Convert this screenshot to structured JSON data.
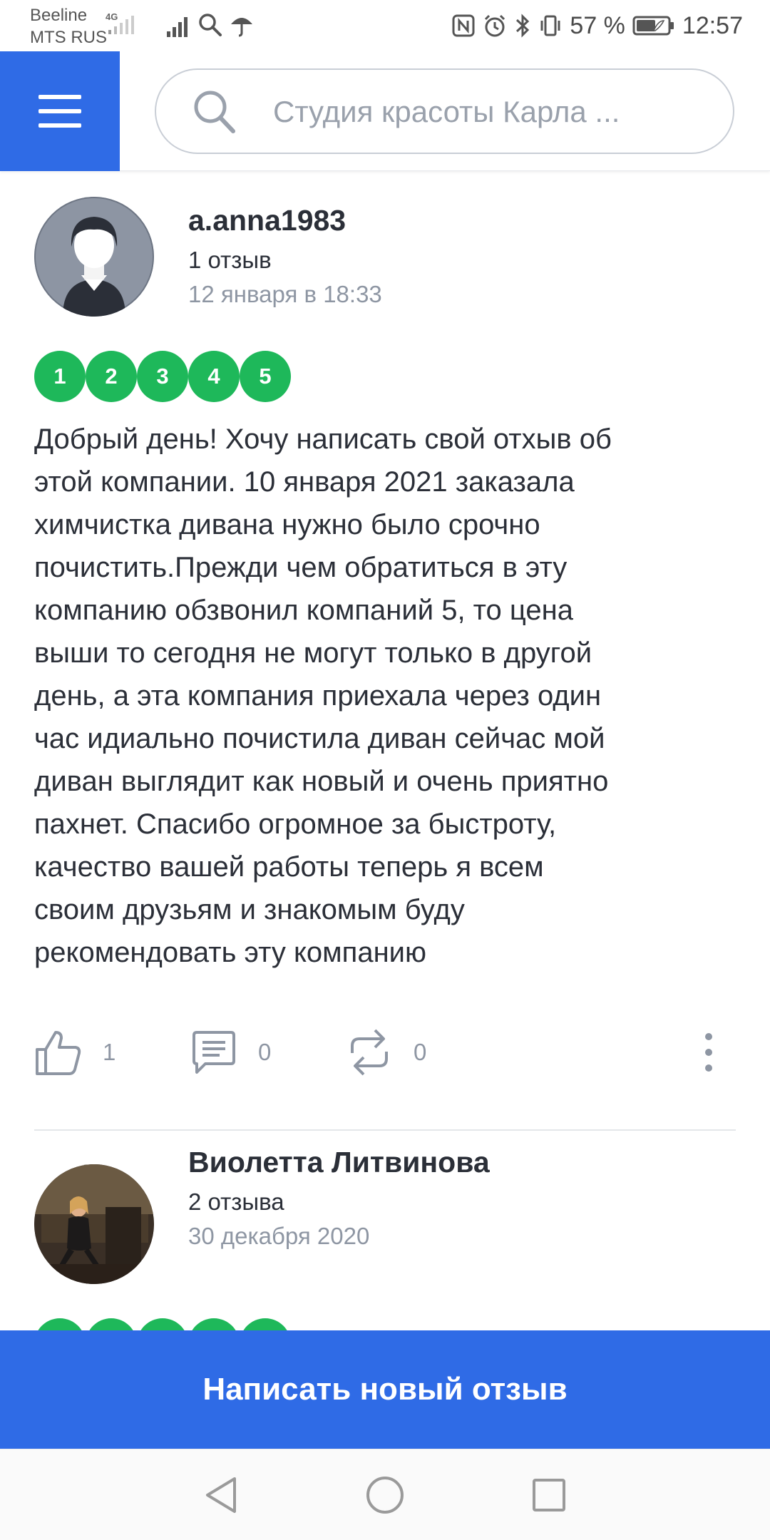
{
  "status_bar": {
    "carrier1": "Beeline",
    "carrier2": "MTS RUS",
    "network": "4G",
    "battery": "57 %",
    "time": "12:57"
  },
  "header": {
    "search_placeholder": "Студия красоты Карла ..."
  },
  "reviews": [
    {
      "author": "a.anna1983",
      "review_count": "1 отзыв",
      "date": "12 января в 18:33",
      "rating": [
        "1",
        "2",
        "3",
        "4",
        "5"
      ],
      "text": "Добрый день! Хочу написать свой отхыв об\nэтой компании. 10 января 2021 заказала\nхимчистка дивана нужно было срочно\nпочистить.Прежди чем обратиться в эту\nкомпанию обзвонил компаний 5, то цена\nвыши то сегодня не могут только в другой\nдень, а эта компания приехала через один\nчас идиально почистила диван сейчас мой\nдиван выглядит как новый и очень приятно\nпахнет. Спасибо огромное за быстроту,\nкачество вашей работы теперь я всем\nсвоим друзьям и знакомым буду\nрекомендовать эту компанию",
      "likes": "1",
      "comments": "0",
      "reposts": "0"
    },
    {
      "author": "Виолетта Литвинова",
      "review_count": "2 отзыва",
      "date": "30 декабря 2020"
    }
  ],
  "cta": {
    "label": "Написать новый отзыв"
  },
  "colors": {
    "accent": "#2f6be6",
    "rating_green": "#1eb85a",
    "muted_text": "#8e96a3"
  }
}
